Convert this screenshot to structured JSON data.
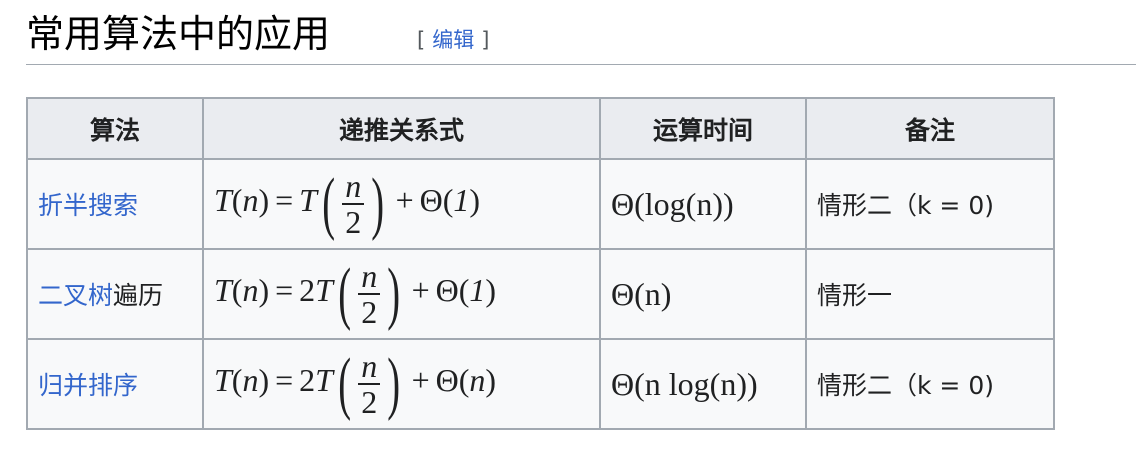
{
  "heading": {
    "title": "常用算法中的应用",
    "edit_open": "[",
    "edit_label": "编辑",
    "edit_close": "]"
  },
  "table": {
    "headers": [
      "算法",
      "递推关系式",
      "运算时间",
      "备注"
    ],
    "rows": [
      {
        "algorithm_link": "折半搜索",
        "algorithm_suffix": "",
        "recurrence": {
          "lhs_T": "T",
          "lhs_n": "n",
          "eq": "=",
          "coef": "",
          "rhs_T": "T",
          "num": "n",
          "den": "2",
          "plus": "+",
          "theta_arg": "1"
        },
        "runtime": "Θ(log(n))",
        "note": "情形二（k = 0)"
      },
      {
        "algorithm_link": "二叉树",
        "algorithm_suffix": "遍历",
        "recurrence": {
          "lhs_T": "T",
          "lhs_n": "n",
          "eq": "=",
          "coef": "2",
          "rhs_T": "T",
          "num": "n",
          "den": "2",
          "plus": "+",
          "theta_arg": "1"
        },
        "runtime": "Θ(n)",
        "note": "情形一"
      },
      {
        "algorithm_link": "归并排序",
        "algorithm_suffix": "",
        "recurrence": {
          "lhs_T": "T",
          "lhs_n": "n",
          "eq": "=",
          "coef": "2",
          "rhs_T": "T",
          "num": "n",
          "den": "2",
          "plus": "+",
          "theta_arg": "n"
        },
        "runtime": "Θ(n log(n))",
        "note": "情形二（k = 0)"
      }
    ]
  }
}
